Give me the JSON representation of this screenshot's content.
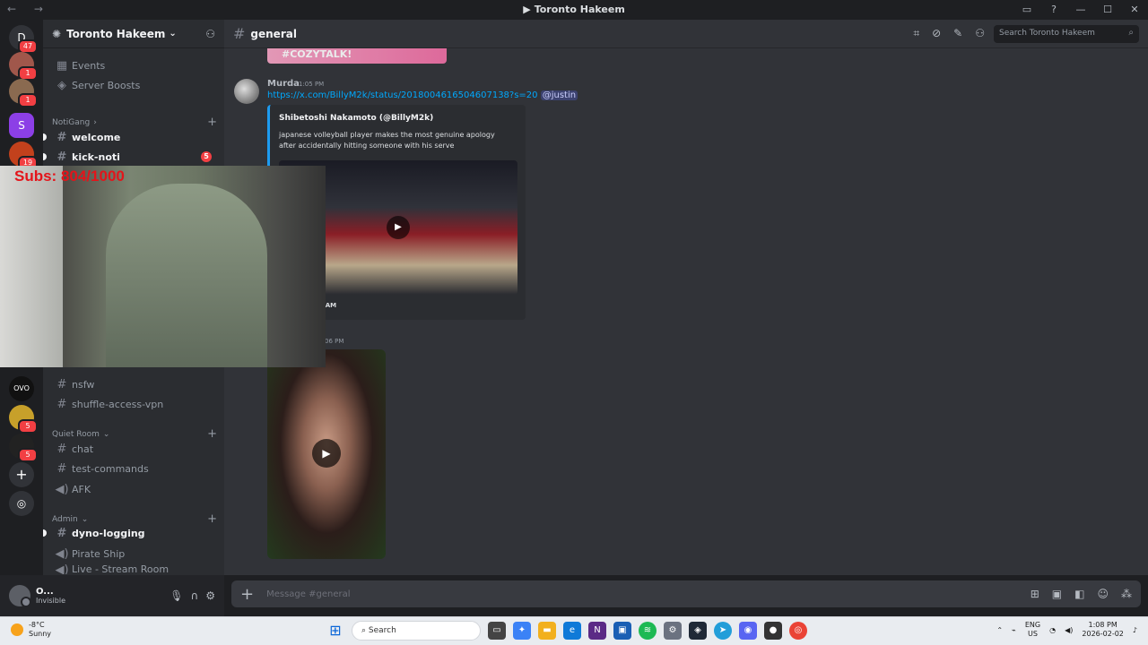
{
  "window": {
    "title": "Toronto Hakeem",
    "nav": "←  →",
    "controls": [
      "▭",
      "?",
      "—",
      "☐",
      "✕"
    ]
  },
  "guilds": [
    {
      "label": "D",
      "badge": "47",
      "color": "#313338"
    },
    {
      "label": "",
      "badge": "1",
      "color": "#a0574b"
    },
    {
      "label": "",
      "badge": "1",
      "color": "#8a6a50"
    },
    {
      "label": "",
      "badge": "",
      "color": "#8c3fe6"
    },
    {
      "label": "",
      "badge": "19",
      "color": "#c2411c"
    },
    {
      "label": "OVO",
      "badge": "",
      "color": "#111111"
    },
    {
      "label": "",
      "badge": "5",
      "color": "#c7a02a"
    },
    {
      "label": "",
      "badge": "5",
      "color": "#222222"
    },
    {
      "label": "+",
      "badge": "",
      "color": "#313338"
    },
    {
      "label": "◎",
      "badge": "",
      "color": "#313338"
    }
  ],
  "sidebar": {
    "server_name": "Toronto Hakeem",
    "items": [
      {
        "label": "Events",
        "icon": "calendar-icon"
      },
      {
        "label": "Server Boosts",
        "icon": "boost-icon"
      }
    ],
    "categories": [
      {
        "label": "NotiGang",
        "channels": [
          {
            "label": "welcome",
            "unread": true
          },
          {
            "label": "kick-noti",
            "unread": true,
            "badge": "5"
          }
        ]
      },
      {
        "label": "",
        "channels": [
          {
            "label": "nsfw",
            "unread": false
          },
          {
            "label": "shuffle-access-vpn",
            "unread": false
          }
        ]
      },
      {
        "label": "Quiet Room",
        "channels": [
          {
            "label": "chat",
            "unread": false
          },
          {
            "label": "test-commands",
            "unread": false
          },
          {
            "label": "AFK",
            "unread": false,
            "voice": true
          }
        ]
      },
      {
        "label": "Admin",
        "channels": [
          {
            "label": "dyno-logging",
            "unread": true
          },
          {
            "label": "Pirate Ship",
            "unread": false,
            "voice": true
          },
          {
            "label": "Live - Stream Room",
            "unread": false,
            "voice": true
          }
        ]
      }
    ]
  },
  "user": {
    "name": "O...",
    "status": "Invisible"
  },
  "channel": {
    "name": "general",
    "search_placeholder": "Search Toronto Hakeem"
  },
  "messages": {
    "top_image_text": "#COZYTALK!",
    "author": "Murda",
    "time": "1:05 PM",
    "link": "https://x.com/BillyM2k/status/2018004616504607138?s=20",
    "mention": "@justin",
    "embed_author": "Shibetoshi Nakamoto (@BillyM2k)",
    "embed_desc": "japanese volleyball player makes the most genuine apology after accidentally hitting someone with his serve",
    "embed_footer": "day at 11:52 AM",
    "time2": "06 PM"
  },
  "composer": {
    "placeholder": "Message #general"
  },
  "overlay": {
    "subs_text": "Subs: 804/1000"
  },
  "taskbar": {
    "weather_temp": "-8°C",
    "weather_desc": "Sunny",
    "search_label": "Search",
    "lang_top": "ENG",
    "lang_bottom": "US",
    "time": "1:08 PM",
    "date": "2026-02-02"
  }
}
